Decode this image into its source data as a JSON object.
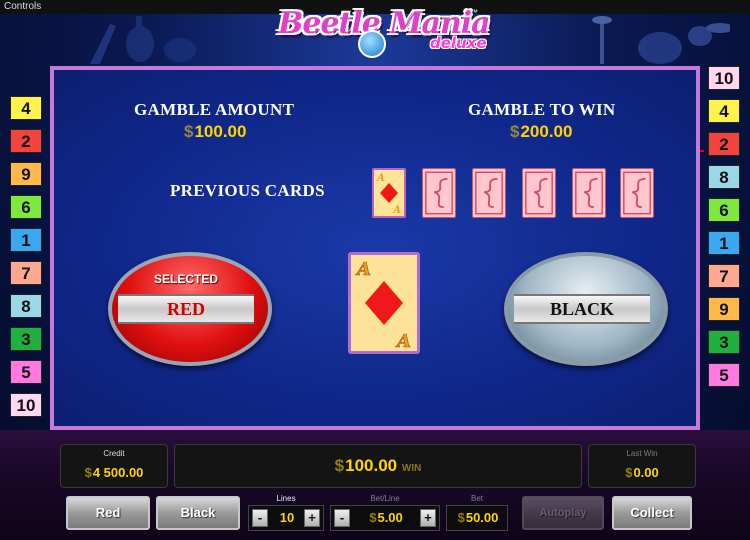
{
  "topbar": {
    "label": "Controls"
  },
  "logo": {
    "title": "Beetle Mania",
    "subtitle": "deluxe",
    "tm": "™"
  },
  "lines_left": [
    {
      "n": "4",
      "color": "#fff24a"
    },
    {
      "n": "2",
      "color": "#f2443c"
    },
    {
      "n": "9",
      "color": "#ffb84a"
    },
    {
      "n": "6",
      "color": "#7ee83c"
    },
    {
      "n": "1",
      "color": "#3aa8f0"
    },
    {
      "n": "7",
      "color": "#ffa890"
    },
    {
      "n": "8",
      "color": "#9ad8e8"
    },
    {
      "n": "3",
      "color": "#20b040"
    },
    {
      "n": "5",
      "color": "#ff7ae0"
    },
    {
      "n": "10",
      "color": "#ffd8f0"
    }
  ],
  "lines_right": [
    {
      "n": "10",
      "color": "#ffd8f0"
    },
    {
      "n": "4",
      "color": "#fff24a"
    },
    {
      "n": "2",
      "color": "#f2443c"
    },
    {
      "n": "8",
      "color": "#9ad8e8"
    },
    {
      "n": "6",
      "color": "#7ee83c"
    },
    {
      "n": "1",
      "color": "#3aa8f0"
    },
    {
      "n": "7",
      "color": "#ffa890"
    },
    {
      "n": "9",
      "color": "#ffb84a"
    },
    {
      "n": "3",
      "color": "#20b040"
    },
    {
      "n": "5",
      "color": "#ff7ae0"
    }
  ],
  "gamble": {
    "amount_label": "GAMBLE AMOUNT",
    "amount_value": "100.00",
    "to_win_label": "GAMBLE TO WIN",
    "to_win_value": "200.00",
    "previous_label": "PREVIOUS CARDS",
    "previous_cards": [
      "A♦",
      "back",
      "back",
      "back",
      "back",
      "back"
    ],
    "current_card": "A♦",
    "red": {
      "selected_text": "SELECTED",
      "label": "RED"
    },
    "black": {
      "label": "BLACK"
    }
  },
  "bottom": {
    "credit_caption": "Credit",
    "credit_value": "4 500.00",
    "win_value": "100.00",
    "win_suffix": "WIN",
    "last_win_caption": "Last Win",
    "last_win_value": "0.00",
    "lines_caption": "Lines",
    "lines_value": "10",
    "bet_line_caption": "Bet/Line",
    "bet_line_value": "5.00",
    "bet_caption": "Bet",
    "bet_value": "50.00",
    "buttons": {
      "red": "Red",
      "black": "Black",
      "autoplay": "Autoplay",
      "collect": "Collect"
    },
    "minus": "-",
    "plus": "+"
  }
}
